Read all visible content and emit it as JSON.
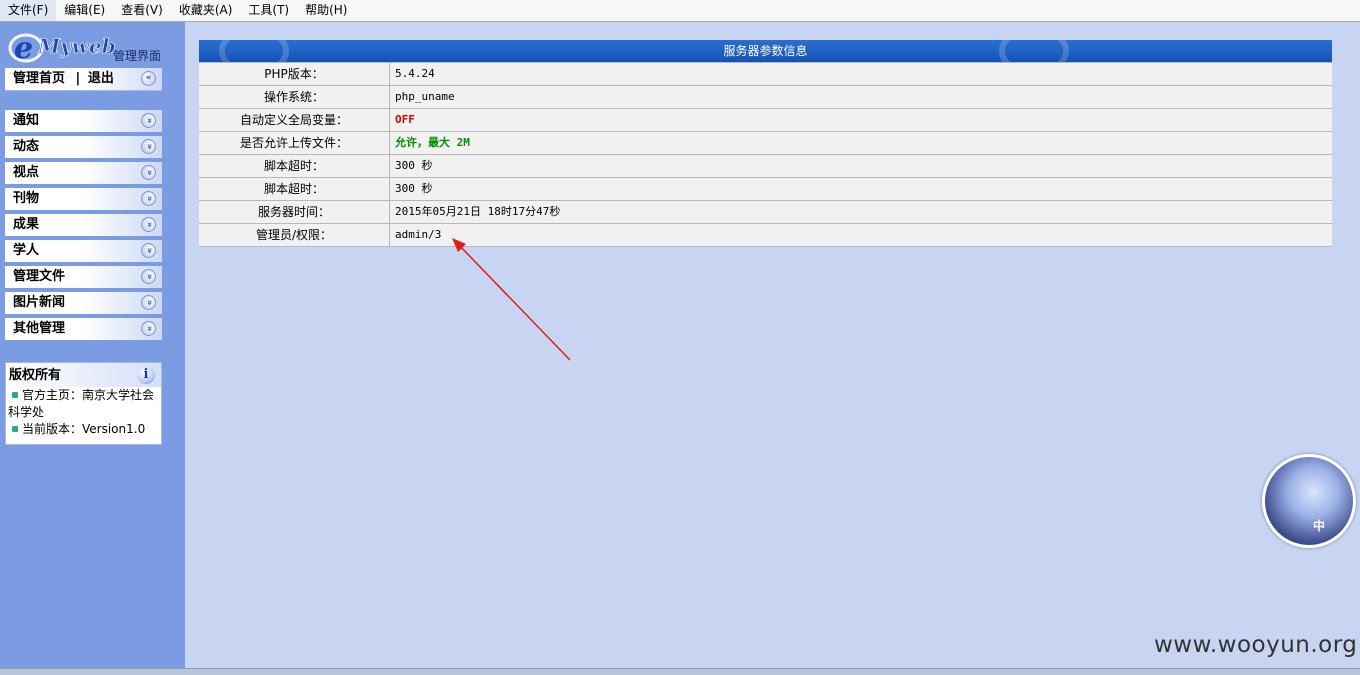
{
  "menubar": {
    "items": [
      {
        "label": "文件(F)"
      },
      {
        "label": "编辑(E)"
      },
      {
        "label": "查看(V)"
      },
      {
        "label": "收藏夹(A)"
      },
      {
        "label": "工具(T)"
      },
      {
        "label": "帮助(H)"
      }
    ]
  },
  "sidebar": {
    "logo_text": "Myweb",
    "logo_subtitle": "管理界面",
    "home_label": "管理首页",
    "separator": "|",
    "logout_label": "退出",
    "collapse_glyph": "«",
    "items": [
      {
        "label": "通知"
      },
      {
        "label": "动态"
      },
      {
        "label": "视点"
      },
      {
        "label": "刊物"
      },
      {
        "label": "成果"
      },
      {
        "label": "学人"
      },
      {
        "label": "管理文件"
      },
      {
        "label": "图片新闻"
      },
      {
        "label": "其他管理"
      }
    ],
    "expand_glyph": "»",
    "copyright": {
      "title": "版权所有",
      "homepage": "官方主页：南京大学社会科学处",
      "version": "当前版本：Version1.0"
    }
  },
  "server_info": {
    "title": "服务器参数信息",
    "rows": [
      {
        "key": "PHP版本：",
        "value": "5.4.24"
      },
      {
        "key": "操作系统：",
        "value": "php_uname"
      },
      {
        "key": "自动定义全局变量：",
        "value": "OFF"
      },
      {
        "key": "是否允许上传文件：",
        "value": "允许，最大 2M"
      },
      {
        "key": "脚本超时：",
        "value": "300 秒"
      },
      {
        "key": "脚本超时：",
        "value": "300 秒"
      },
      {
        "key": "服务器时间：",
        "value": "2015年05月21日 18时17分47秒"
      },
      {
        "key": "管理员/权限：",
        "value": "admin/3"
      }
    ]
  },
  "avatar": {
    "label": "中"
  },
  "watermark": "www.wooyun.org",
  "colors": {
    "sidebar_bg": "#7b9be3",
    "main_bg": "#c7d5f3",
    "table_header": "#1a5cbf",
    "off_red": "#e00000",
    "allow_green": "#078c07",
    "annotation_arrow": "#e31b1b"
  }
}
